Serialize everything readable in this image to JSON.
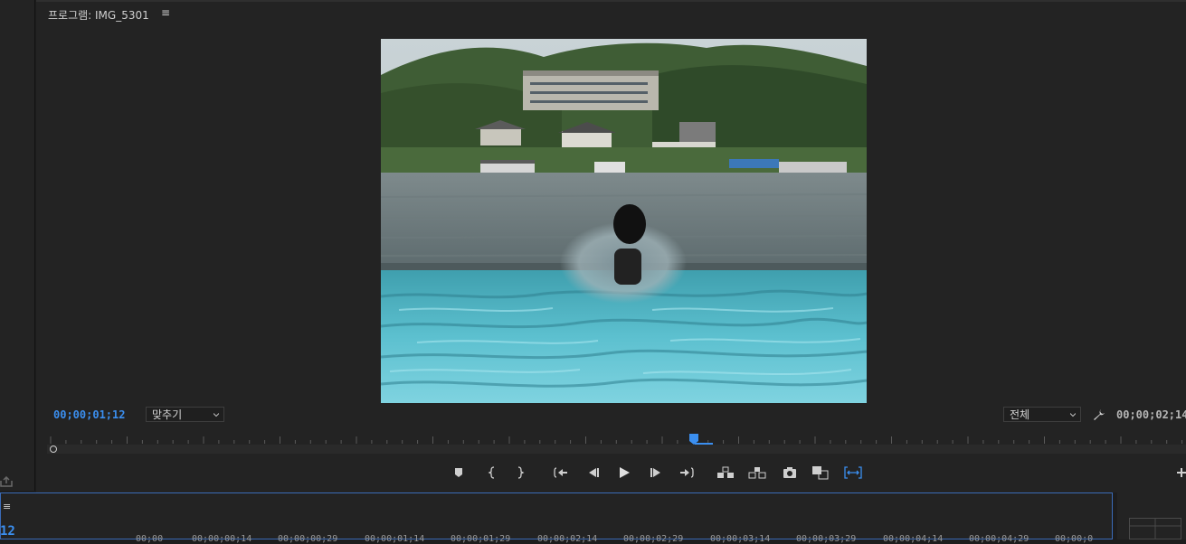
{
  "monitor": {
    "title": "프로그램: IMG_5301",
    "menu_icon": "≡",
    "current_timecode": "00;00;01;12",
    "duration_timecode": "00;00;02;14",
    "fit_dropdown": "맞추기",
    "resolution_dropdown": "전체"
  },
  "controls": [
    "add-marker-icon",
    "mark-in-icon",
    "mark-out-icon",
    "go-to-in-icon",
    "step-back-icon",
    "play-icon",
    "step-forward-icon",
    "go-to-out-icon",
    "lift-icon",
    "extract-icon",
    "export-frame-icon",
    "comparison-view-icon",
    "trim-view-icon",
    "add-button-icon"
  ],
  "timeline": {
    "menu_icon": "≡",
    "current_timecode": "12",
    "tick_labels": [
      "00;00",
      "00;00;00;14",
      "00;00;00;29",
      "00;00;01;14",
      "00;00;01;29",
      "00;00;02;14",
      "00;00;02;29",
      "00;00;03;14",
      "00;00;03;29",
      "00;00;04;14",
      "00;00;04;29",
      "00;00;0"
    ]
  },
  "colors": {
    "accent": "#3b8ff0",
    "panel": "#232323"
  }
}
